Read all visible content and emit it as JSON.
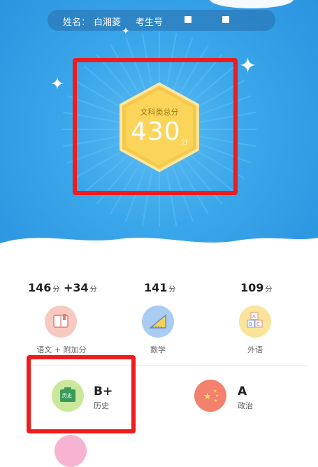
{
  "header": {
    "name_label": "姓名：",
    "name_value": "白湘菱",
    "exam_label": "考生号"
  },
  "total": {
    "label": "文科类总分",
    "score": "430",
    "unit": "分"
  },
  "subjects": [
    {
      "score": "146",
      "unit": "分",
      "extra": "+34",
      "extra_unit": "分",
      "label": "语文 + 附加分",
      "icon": "book-icon",
      "color": "#f8c9c0"
    },
    {
      "score": "141",
      "unit": "分",
      "label": "数学",
      "icon": "ruler-triangle-icon",
      "color": "#a9cdf2"
    },
    {
      "score": "109",
      "unit": "分",
      "label": "外语",
      "icon": "abc-blocks-icon",
      "color": "#fbe39a"
    }
  ],
  "grades": [
    {
      "grade": "B+",
      "label": "历史",
      "icon": "history-book-icon",
      "icon_text": "历史",
      "color": "#c9e89a"
    },
    {
      "grade": "A",
      "label": "政治",
      "icon": "china-flag-icon",
      "color": "#f4816d"
    }
  ]
}
